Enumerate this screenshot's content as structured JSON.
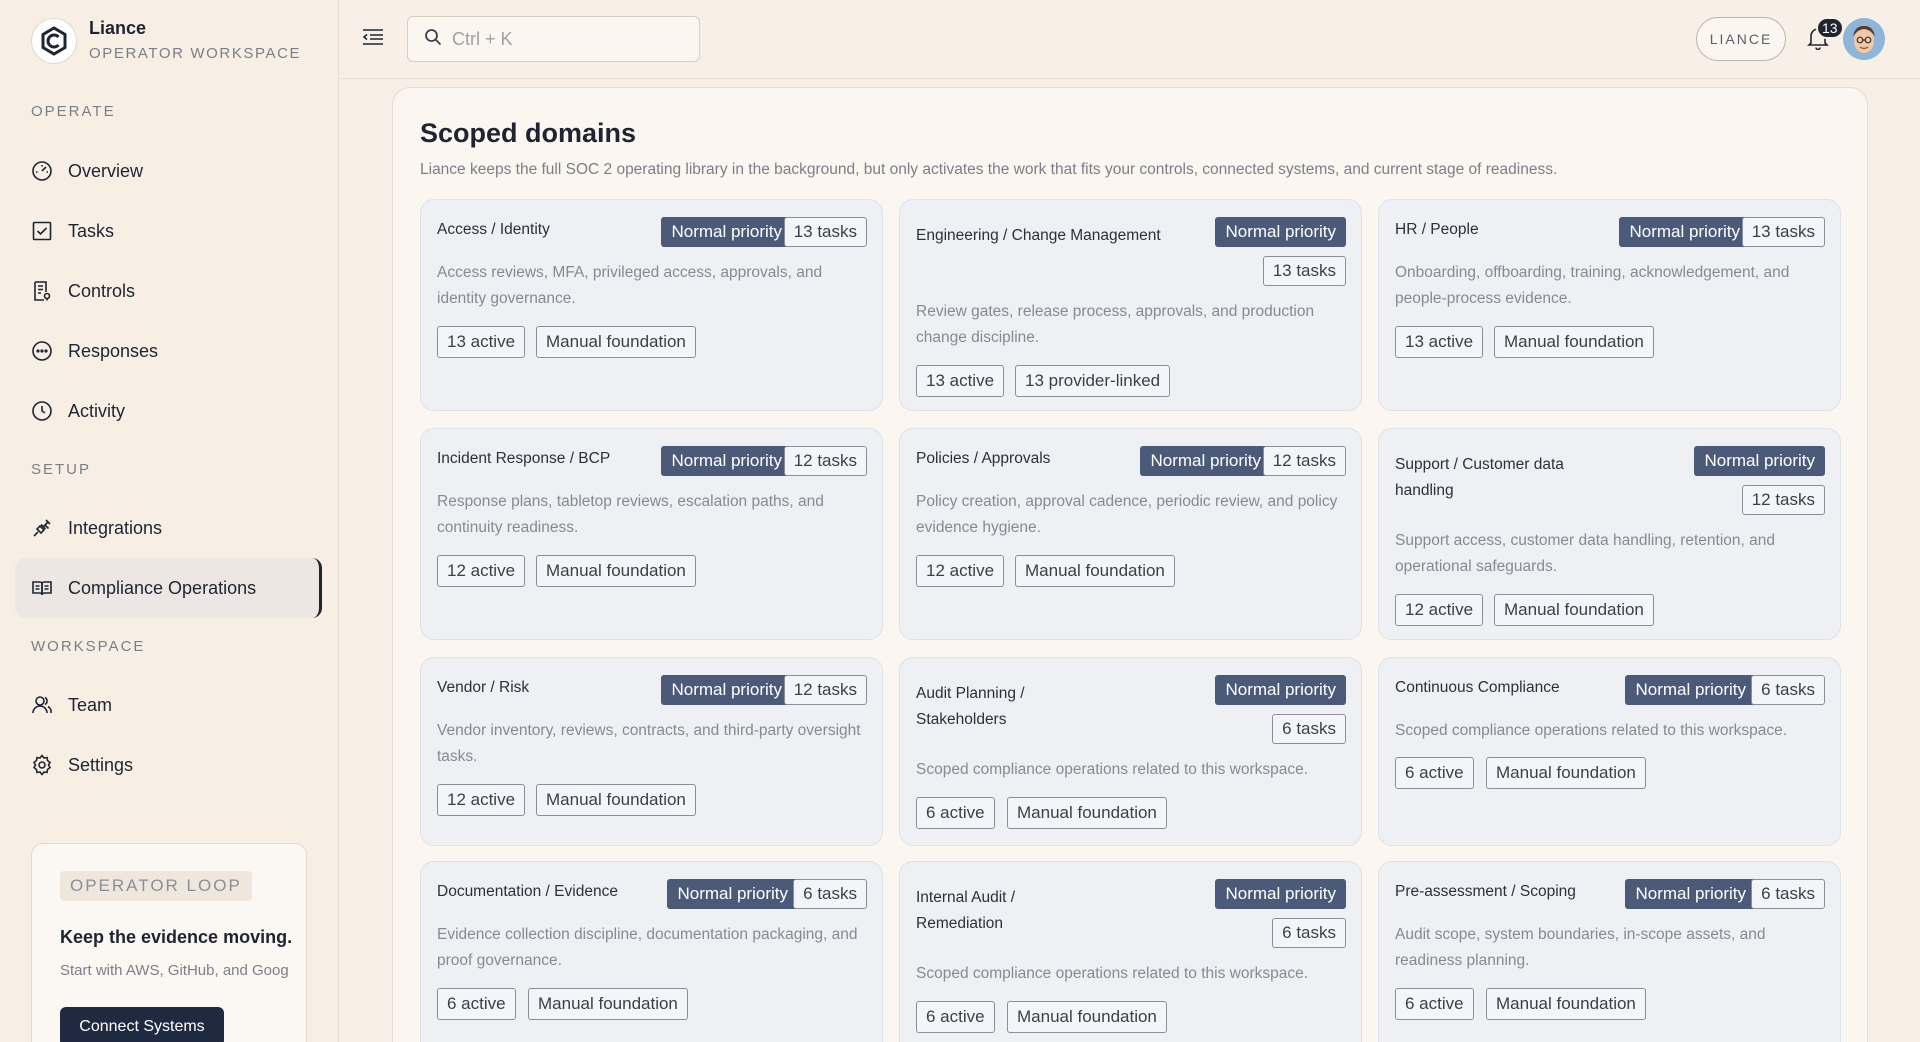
{
  "brand": {
    "name": "Liance",
    "subtitle": "OPERATOR WORKSPACE"
  },
  "sidebar": {
    "sections": {
      "operate": "OPERATE",
      "setup": "SETUP",
      "workspace": "WORKSPACE"
    },
    "items": [
      {
        "label": "Overview",
        "icon": "gauge-icon"
      },
      {
        "label": "Tasks",
        "icon": "checkbox-icon"
      },
      {
        "label": "Controls",
        "icon": "document-icon"
      },
      {
        "label": "Responses",
        "icon": "chat-bubble-icon"
      },
      {
        "label": "Activity",
        "icon": "clock-icon"
      },
      {
        "label": "Integrations",
        "icon": "plug-icon"
      },
      {
        "label": "Compliance Operations",
        "icon": "book-icon",
        "active": true
      },
      {
        "label": "Team",
        "icon": "user-icon"
      },
      {
        "label": "Settings",
        "icon": "gear-icon"
      }
    ],
    "loop": {
      "badge": "OPERATOR LOOP",
      "title": "Keep the evidence moving.",
      "desc": "Start with AWS, GitHub, and Goog",
      "button": "Connect Systems"
    }
  },
  "topbar": {
    "search_placeholder": "Ctrl + K",
    "org": "LIANCE",
    "notifications": "13"
  },
  "main": {
    "title": "Scoped domains",
    "desc": "Liance keeps the full SOC 2 operating library in the background, but only activates the work that fits your controls, connected systems, and current stage of readiness.",
    "domains": [
      {
        "name": "Access / Identity",
        "priority": "Normal priority",
        "tasks": "13 tasks",
        "desc": "Access reviews, MFA, privileged access, approvals, and identity governance.",
        "active": "13 active",
        "tag": "Manual foundation"
      },
      {
        "name": "Engineering / Change Management",
        "priority": "Normal priority",
        "tasks": "13 tasks",
        "desc": "Review gates, release process, approvals, and production change discipline.",
        "active": "13 active",
        "tag": "13 provider-linked"
      },
      {
        "name": "HR / People",
        "priority": "Normal priority",
        "tasks": "13 tasks",
        "desc": "Onboarding, offboarding, training, acknowledgement, and people-process evidence.",
        "active": "13 active",
        "tag": "Manual foundation"
      },
      {
        "name": "Incident Response / BCP",
        "priority": "Normal priority",
        "tasks": "12 tasks",
        "desc": "Response plans, tabletop reviews, escalation paths, and continuity readiness.",
        "active": "12 active",
        "tag": "Manual foundation"
      },
      {
        "name": "Policies / Approvals",
        "priority": "Normal priority",
        "tasks": "12 tasks",
        "desc": "Policy creation, approval cadence, periodic review, and policy evidence hygiene.",
        "active": "12 active",
        "tag": "Manual foundation"
      },
      {
        "name": "Support / Customer data handling",
        "priority": "Normal priority",
        "tasks": "12 tasks",
        "desc": "Support access, customer data handling, retention, and operational safeguards.",
        "active": "12 active",
        "tag": "Manual foundation"
      },
      {
        "name": "Vendor / Risk",
        "priority": "Normal priority",
        "tasks": "12 tasks",
        "desc": "Vendor inventory, reviews, contracts, and third-party oversight tasks.",
        "active": "12 active",
        "tag": "Manual foundation"
      },
      {
        "name": "Audit Planning / Stakeholders",
        "priority": "Normal priority",
        "tasks": "6 tasks",
        "desc": "Scoped compliance operations related to this workspace.",
        "active": "6 active",
        "tag": "Manual foundation"
      },
      {
        "name": "Continuous Compliance",
        "priority": "Normal priority",
        "tasks": "6 tasks",
        "desc": "Scoped compliance operations related to this workspace.",
        "active": "6 active",
        "tag": "Manual foundation"
      },
      {
        "name": "Documentation / Evidence",
        "priority": "Normal priority",
        "tasks": "6 tasks",
        "desc": "Evidence collection discipline, documentation packaging, and proof governance.",
        "active": "6 active",
        "tag": "Manual foundation"
      },
      {
        "name": "Internal Audit / Remediation",
        "priority": "Normal priority",
        "tasks": "6 tasks",
        "desc": "Scoped compliance operations related to this workspace.",
        "active": "6 active",
        "tag": "Manual foundation"
      },
      {
        "name": "Pre-assessment / Scoping",
        "priority": "Normal priority",
        "tasks": "6 tasks",
        "desc": "Audit scope, system boundaries, in-scope assets, and readiness planning.",
        "active": "6 active",
        "tag": "Manual foundation"
      }
    ]
  }
}
